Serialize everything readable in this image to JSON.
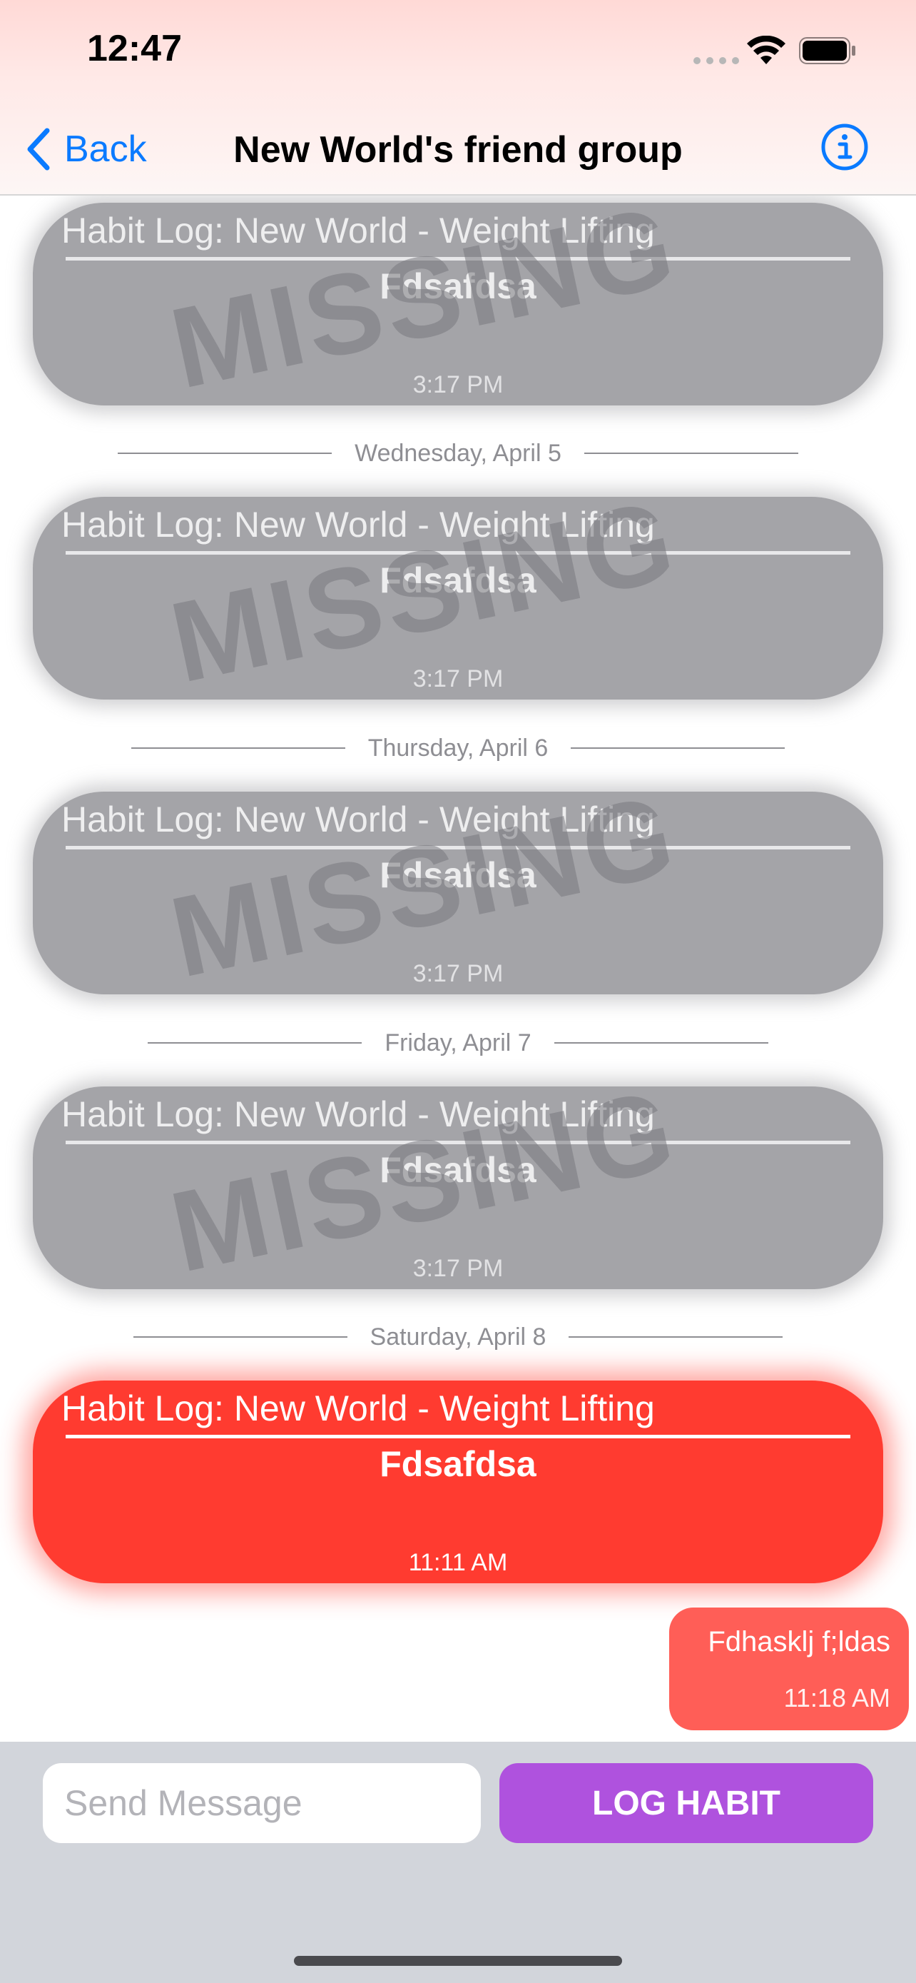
{
  "status_bar": {
    "time": "12:47"
  },
  "nav": {
    "back_label": "Back",
    "title": "New World's friend group"
  },
  "messages": [
    {
      "type": "habit",
      "state": "missing",
      "title": "Habit Log:  New World - Weight Lifting",
      "body": "Fdsafdsa",
      "time": "3:17 PM",
      "overlay": "MISSING"
    },
    {
      "type": "habit",
      "state": "missing",
      "title": "Habit Log:  New World - Weight Lifting",
      "body": "Fdsafdsa",
      "time": "3:17 PM",
      "overlay": "MISSING"
    },
    {
      "type": "habit",
      "state": "missing",
      "title": "Habit Log:  New World - Weight Lifting",
      "body": "Fdsafdsa",
      "time": "3:17 PM",
      "overlay": "MISSING"
    },
    {
      "type": "habit",
      "state": "missing",
      "title": "Habit Log:  New World - Weight Lifting",
      "body": "Fdsafdsa",
      "time": "3:17 PM",
      "overlay": "MISSING"
    },
    {
      "type": "habit",
      "state": "logged",
      "title": "Habit Log:  New World - Weight Lifting",
      "body": "Fdsafdsa",
      "time": "11:11 AM"
    }
  ],
  "date_separators": [
    "Wednesday, April 5",
    "Thursday, April 6",
    "Friday, April 7",
    "Saturday, April 8"
  ],
  "own_message": {
    "text": "Fdhasklj f;ldas",
    "time": "11:18 AM"
  },
  "composer": {
    "placeholder": "Send Message",
    "value": "",
    "log_button_label": "LOG HABIT"
  },
  "colors": {
    "accent_blue": "#0a7aff",
    "missing_grey": "#a4a4a8",
    "logged_red": "#ff3b30",
    "own_bubble": "#ff5e57",
    "log_button": "#af52de",
    "composer_bg": "#d2d5db"
  }
}
